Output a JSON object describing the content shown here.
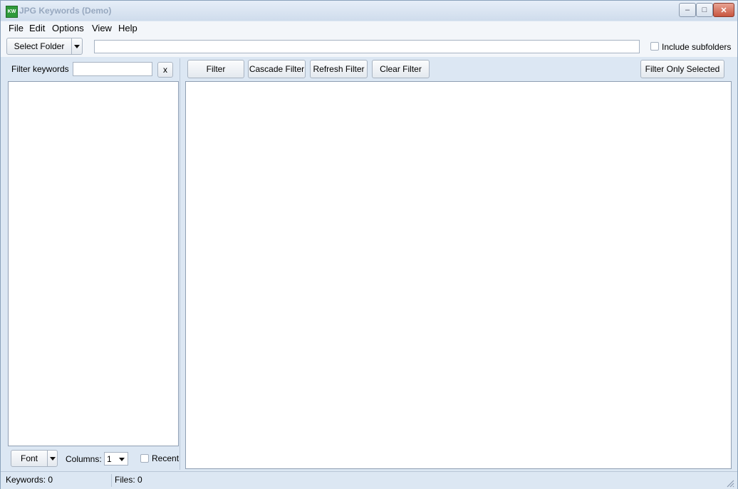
{
  "window": {
    "app_icon_text": "KW",
    "title": "JPG Keywords (Demo)",
    "minimize_glyph": "–",
    "maximize_glyph": "□",
    "close_glyph": "✕"
  },
  "menu": [
    "File",
    "Edit",
    "Options",
    "View",
    "Help"
  ],
  "toolbar": {
    "select_folder_label": "Select Folder",
    "path_value": "",
    "include_subfolders_label": "Include subfolders",
    "include_subfolders_checked": false
  },
  "left_panel": {
    "filter_keywords_label": "Filter keywords",
    "filter_value": "",
    "clear_label": "x",
    "font_label": "Font",
    "columns_label": "Columns:",
    "columns_value": "1",
    "recent_label": "Recent",
    "recent_checked": false
  },
  "right_panel": {
    "filter_label": "Filter",
    "cascade_filter_label": "Cascade Filter",
    "refresh_filter_label": "Refresh Filter",
    "clear_filter_label": "Clear Filter",
    "filter_only_selected_label": "Filter Only Selected"
  },
  "status": {
    "keywords": "Keywords: 0",
    "files": "Files: 0"
  },
  "colors": {
    "title_text": "#97a8bf",
    "app_icon": "#2f9a3b",
    "window_bg": "#dce7f3"
  }
}
